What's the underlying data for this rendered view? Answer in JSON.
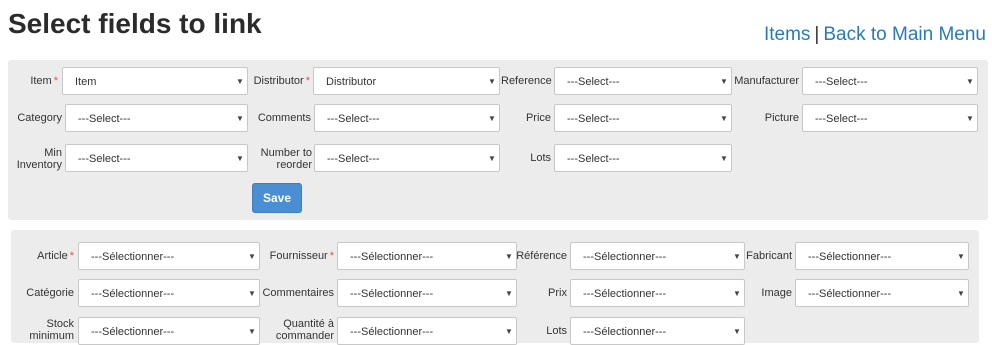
{
  "page": {
    "title": "Select fields to link",
    "links": {
      "items": "Items",
      "separator": "|",
      "back": "Back to Main Menu"
    }
  },
  "en": {
    "fields": {
      "item": {
        "label": "Item",
        "value": "Item"
      },
      "distributor": {
        "label": "Distributor",
        "value": "Distributor"
      },
      "reference": {
        "label": "Reference",
        "value": "---Select---"
      },
      "manufacturer": {
        "label": "Manufacturer",
        "value": "---Select---"
      },
      "category": {
        "label": "Category",
        "value": "---Select---"
      },
      "comments": {
        "label": "Comments",
        "value": "---Select---"
      },
      "price": {
        "label": "Price",
        "value": "---Select---"
      },
      "picture": {
        "label": "Picture",
        "value": "---Select---"
      },
      "min_inventory": {
        "label": "Min Inventory",
        "value": "---Select---"
      },
      "number_to_reorder": {
        "label": "Number to reorder",
        "value": "---Select---"
      },
      "lots": {
        "label": "Lots",
        "value": "---Select---"
      }
    },
    "save_label": "Save"
  },
  "fr": {
    "fields": {
      "article": {
        "label": "Article",
        "value": "---Sélectionner---"
      },
      "fournisseur": {
        "label": "Fournisseur",
        "value": "---Sélectionner---"
      },
      "reference": {
        "label": "Référence",
        "value": "---Sélectionner---"
      },
      "fabricant": {
        "label": "Fabricant",
        "value": "---Sélectionner---"
      },
      "categorie": {
        "label": "Catégorie",
        "value": "---Sélectionner---"
      },
      "commentaires": {
        "label": "Commentaires",
        "value": "---Sélectionner---"
      },
      "prix": {
        "label": "Prix",
        "value": "---Sélectionner---"
      },
      "image": {
        "label": "Image",
        "value": "---Sélectionner---"
      },
      "stock_minimum": {
        "label": "Stock minimum",
        "value": "---Sélectionner---"
      },
      "quantite_a_commander": {
        "label": "Quantité à commander",
        "value": "---Sélectionner---"
      },
      "lots": {
        "label": "Lots",
        "value": "---Sélectionner---"
      }
    }
  },
  "required_marker": "*",
  "colors": {
    "link": "#2a7ab8",
    "required": "#d9534f",
    "save_button": "#4a8fd4",
    "panel": "#ececec"
  }
}
